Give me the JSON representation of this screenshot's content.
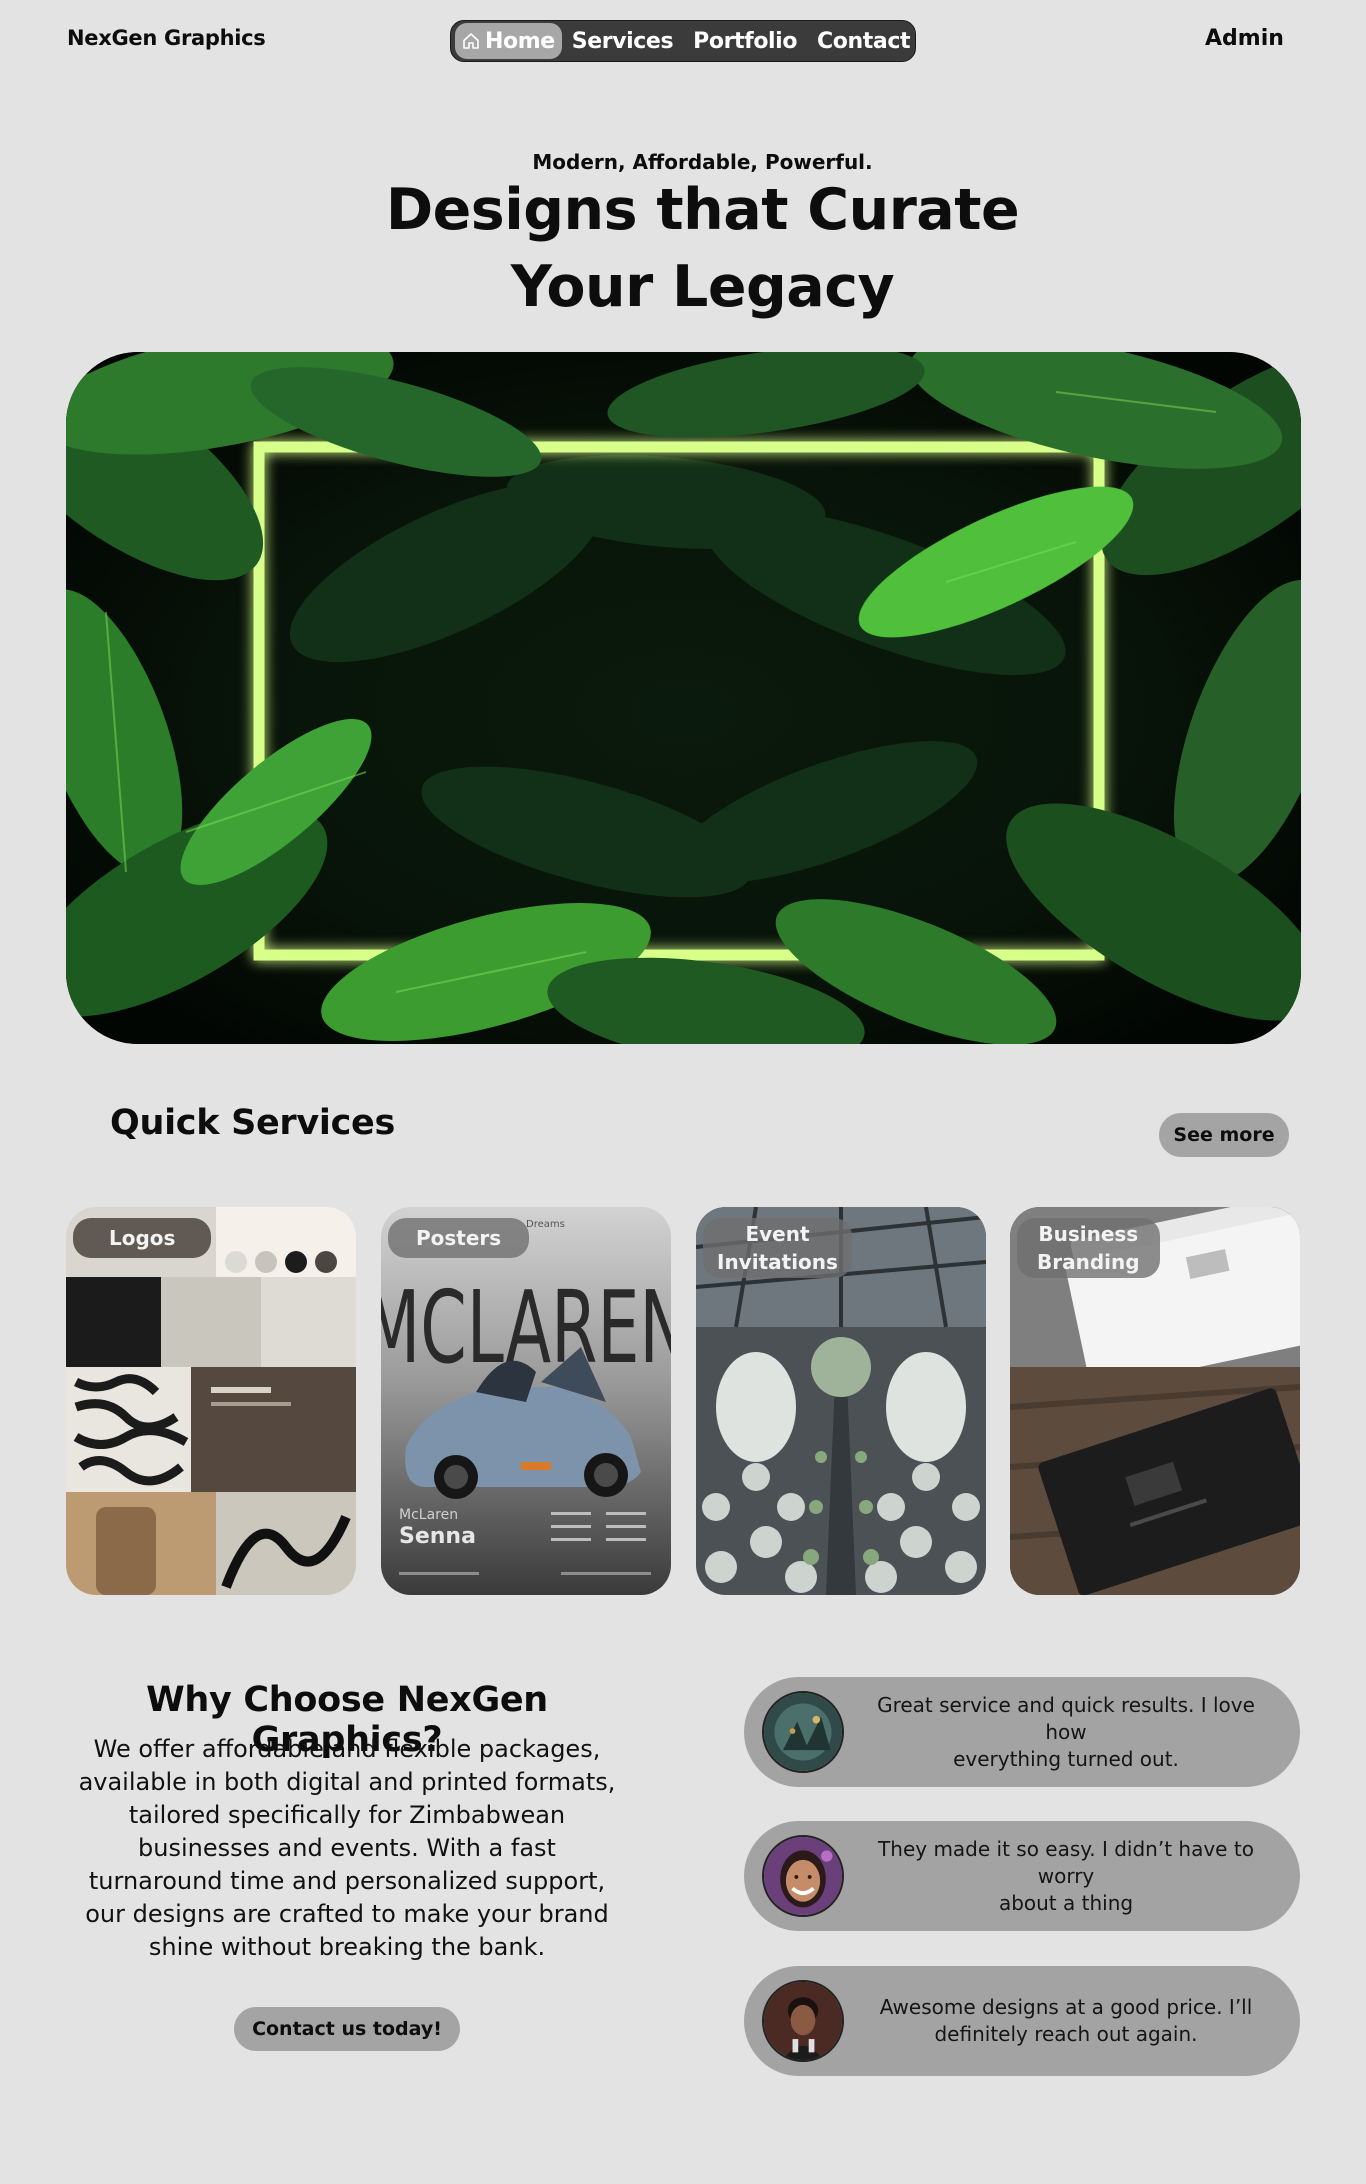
{
  "header": {
    "brand": "NexGen Graphics",
    "nav": [
      {
        "label": "Home",
        "icon": "home-icon",
        "active": true
      },
      {
        "label": "Services"
      },
      {
        "label": "Portfolio"
      },
      {
        "label": "Contact"
      }
    ],
    "admin": "Admin"
  },
  "hero": {
    "tagline": "Modern, Affordable, Powerful.",
    "headline_line1": "Designs that Curate",
    "headline_line2": "Your Legacy",
    "image": "tropical-leaves-neon-frame"
  },
  "quick_services": {
    "title": "Quick Services",
    "see_more": "See more",
    "cards": [
      {
        "label": "Logos",
        "image": "logo-moodboard"
      },
      {
        "label": "Posters",
        "image": "mclaren-poster",
        "poster_brand": "MCLAREN",
        "poster_model": "McLaren",
        "poster_name": "Senna",
        "poster_top": "Dreams"
      },
      {
        "label_line1": "Event",
        "label_line2": "Invitations",
        "image": "wedding-venue"
      },
      {
        "label_line1": "Business",
        "label_line2": "Branding",
        "image": "business-cards"
      }
    ]
  },
  "why": {
    "title": "Why Choose NexGen Graphics?",
    "lines": [
      "We offer affordable and flexible packages,",
      "available in both digital and printed formats,",
      "tailored specifically for Zimbabwean",
      "businesses and events. With a fast",
      "turnaround time and personalized support,",
      "our designs are crafted to make your brand",
      "shine without breaking the bank."
    ],
    "cta": "Contact us today!"
  },
  "testimonials": [
    {
      "line1": "Great service and quick results. I love how",
      "line2": "everything turned out.",
      "avatar": "forest-avatar"
    },
    {
      "line1": "They made it so easy. I didn’t have to worry",
      "line2": "about a thing",
      "avatar": "smiling-woman-avatar"
    },
    {
      "line1": "Awesome designs at a good price. I’ll",
      "line2": "definitely reach out again.",
      "avatar": "man-portrait-avatar"
    }
  ],
  "colors": {
    "background": "#e3e3e3",
    "nav_bg": "#3b3b3b",
    "pill": "#a4a4a4",
    "neon": "#d8ff8a"
  }
}
